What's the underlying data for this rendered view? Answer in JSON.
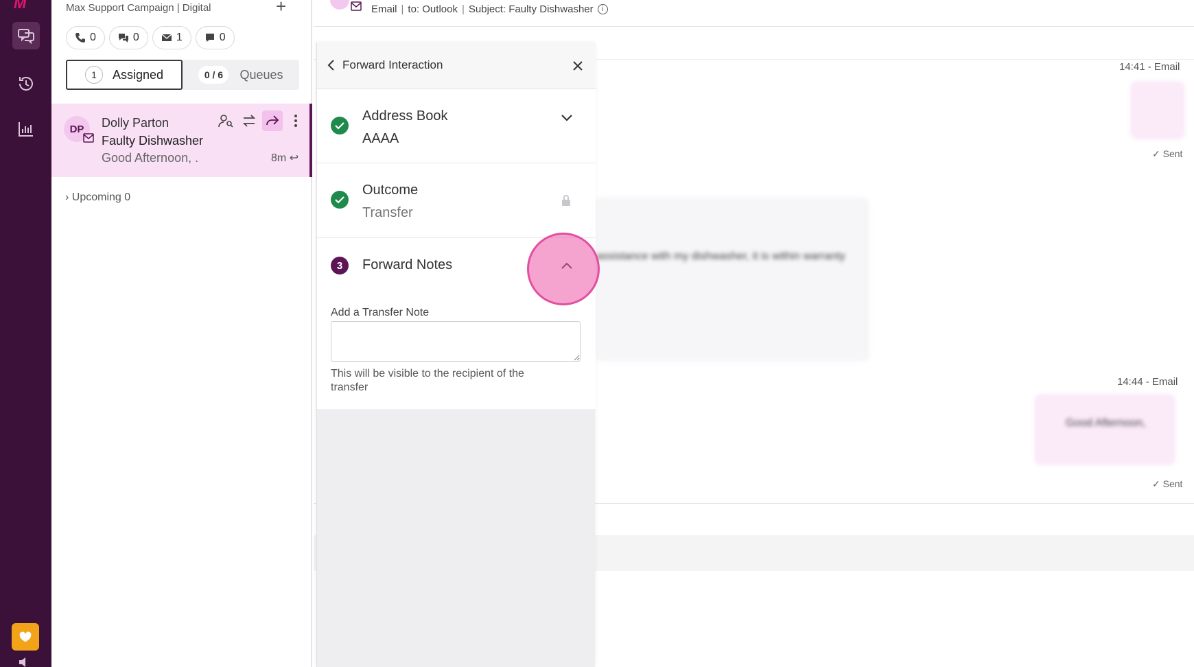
{
  "rail": {
    "logo": "M",
    "colors": {
      "background": "#3b1139",
      "helper": "#f2a31a"
    }
  },
  "list": {
    "campaign": "Max Support Campaign | Digital",
    "add_label": "+",
    "counters": [
      {
        "icon": "phone-icon",
        "value": "0"
      },
      {
        "icon": "chat-icon",
        "value": "0"
      },
      {
        "icon": "mail-icon",
        "value": "1"
      },
      {
        "icon": "message-icon",
        "value": "0"
      }
    ],
    "tabs": {
      "assigned_count": "1",
      "assigned_label": "Assigned",
      "queues_count": "0 / 6",
      "queues_label": "Queues"
    },
    "card": {
      "initials": "DP",
      "name": "Dolly Parton",
      "subject": "Faulty Dishwasher",
      "preview": "Good Afternoon, .",
      "age": "8m"
    },
    "upcoming": "Upcoming 0"
  },
  "conversation": {
    "header": {
      "channel": "Email",
      "to": "to: Outlook",
      "subject": "Subject: Faulty Dishwasher"
    },
    "messages": [
      {
        "timestamp": "14:41 - Email",
        "status": "Sent"
      },
      {
        "body": "assistance with my dishwasher, it is within warranty"
      },
      {
        "timestamp": "14:44 - Email",
        "body": "Good Afternoon,",
        "status": "Sent"
      }
    ]
  },
  "forward_panel": {
    "title": "Forward Interaction",
    "steps": [
      {
        "label": "Address Book",
        "value": "AAAA",
        "state": "done"
      },
      {
        "label": "Outcome",
        "value": "Transfer",
        "state": "done-locked"
      },
      {
        "number": "3",
        "label": "Forward Notes",
        "state": "active"
      }
    ],
    "note_label": "Add a Transfer Note",
    "note_value": "",
    "note_help": "This will be visible to the recipient of the transfer"
  },
  "colors": {
    "accent": "#5c1554",
    "success": "#1e8a4c",
    "highlight": "#f9e0f5"
  }
}
